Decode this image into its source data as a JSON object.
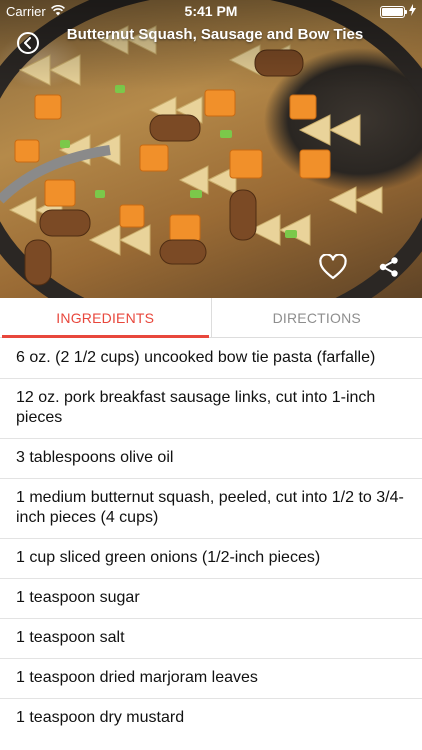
{
  "status_bar": {
    "carrier": "Carrier",
    "time": "5:41 PM",
    "icons": [
      "wifi-icon",
      "battery-icon",
      "charging-bolt-icon"
    ],
    "battery_level": 1.0
  },
  "header": {
    "title": "Butternut Squash, Sausage and Bow Ties",
    "back_icon": "chevron-left-icon",
    "favorite_icon": "heart-icon",
    "share_icon": "share-icon"
  },
  "tabs": [
    {
      "label": "INGREDIENTS",
      "active": true
    },
    {
      "label": "DIRECTIONS",
      "active": false
    }
  ],
  "colors": {
    "accent": "#e8473c",
    "inactive_tab": "#8e8e8e",
    "divider": "#e3e3e3"
  },
  "ingredients": [
    "6 oz. (2 1/2 cups) uncooked bow tie pasta (farfalle)",
    "12 oz. pork breakfast sausage links, cut into 1-inch pieces",
    "3 tablespoons olive oil",
    "1 medium butternut squash, peeled, cut into 1/2 to 3/4- inch pieces (4 cups)",
    "1 cup sliced green onions (1/2-inch pieces)",
    "1 teaspoon sugar",
    "1 teaspoon salt",
    "1 teaspoon dried marjoram leaves",
    "1 teaspoon dry mustard"
  ]
}
